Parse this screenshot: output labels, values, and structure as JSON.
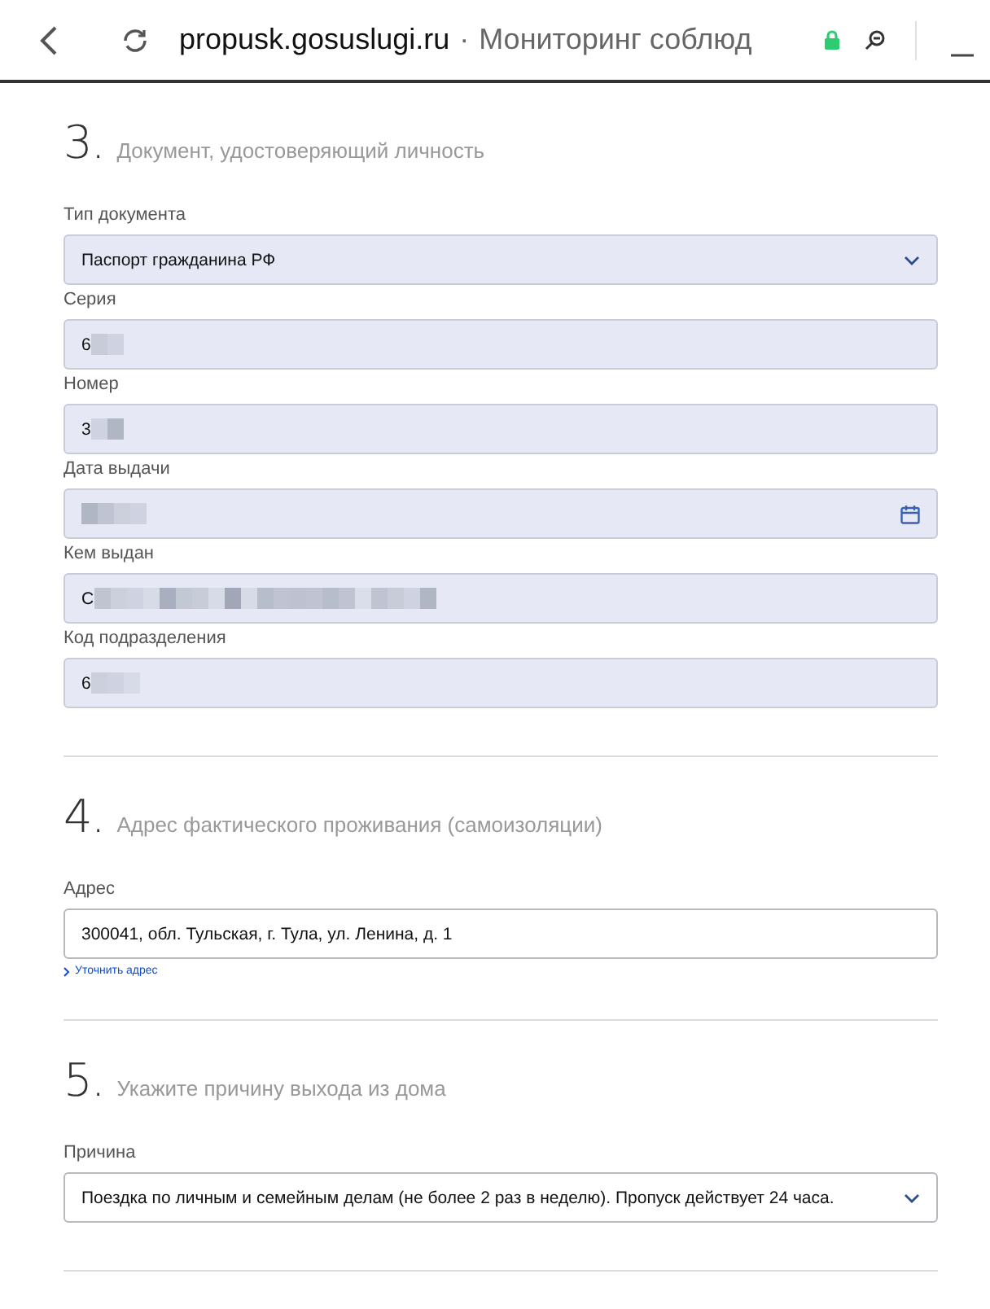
{
  "browser": {
    "domain": "propusk.gosuslugi.ru",
    "separator": "·",
    "title": "Мониторинг соблюд"
  },
  "sections": [
    {
      "number": "3.",
      "title": "Документ, удостоверяющий личность",
      "divider": true,
      "fields": [
        {
          "kind": "select",
          "label": "Тип документа",
          "value": "Паспорт гражданина РФ",
          "filled": true
        },
        {
          "kind": "text",
          "label": "Серия",
          "value": "6",
          "filled": true,
          "blurred": true
        },
        {
          "kind": "text",
          "label": "Номер",
          "value": "3",
          "filled": true,
          "blurred": true
        },
        {
          "kind": "date",
          "label": "Дата выдачи",
          "filled": true,
          "blurred": true
        },
        {
          "kind": "text",
          "label": "Кем выдан",
          "value": "С",
          "filled": true,
          "blurred": true
        },
        {
          "kind": "text",
          "label": "Код подразделения",
          "value": "6",
          "filled": true,
          "blurred": true
        }
      ]
    },
    {
      "number": "4.",
      "title": "Адрес фактического проживания (самоизоляции)",
      "divider": true,
      "fields": [
        {
          "kind": "text",
          "label": "Адрес",
          "value": "300041, обл. Тульская, г. Тула, ул. Ленина, д. 1",
          "filled": false,
          "link": "Уточнить адрес"
        }
      ]
    },
    {
      "number": "5.",
      "title": "Укажите причину выхода из дома",
      "divider": true,
      "fields": [
        {
          "kind": "select",
          "label": "Причина",
          "value": "Поездка по личным и семейным делам (не более 2 раз в неделю). Пропуск действует 24 часа.",
          "filled": false
        }
      ]
    }
  ]
}
